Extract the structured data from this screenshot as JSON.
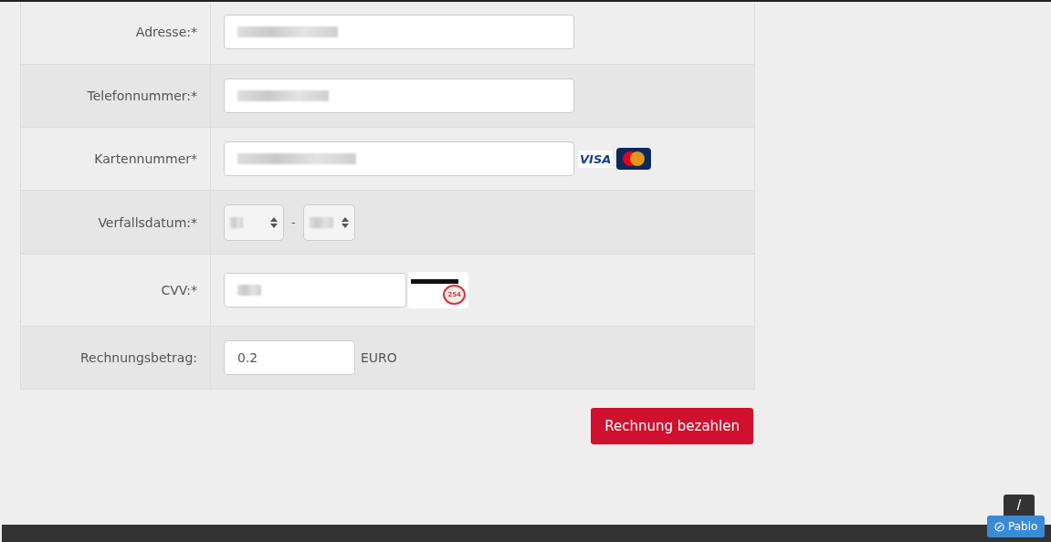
{
  "form_rows": [
    {
      "label": "Adresse:*",
      "kind": "masked_text"
    },
    {
      "label": "Telefonnummer:*",
      "kind": "masked_text"
    },
    {
      "label": "Kartennummer*",
      "kind": "card_number",
      "brands": [
        "VISA"
      ]
    },
    {
      "label": "Verfallsdatum:*",
      "kind": "expiry",
      "separator": "-"
    },
    {
      "label": "CVV:*",
      "kind": "cvv",
      "hint_code": "254"
    },
    {
      "label": "Rechnungsbetrag:",
      "kind": "amount",
      "value": "0.2",
      "unit": "EURO"
    }
  ],
  "submit_button": "Rechnung bezahlen",
  "scroll_top_button": "/",
  "user_badge": "Pablo"
}
